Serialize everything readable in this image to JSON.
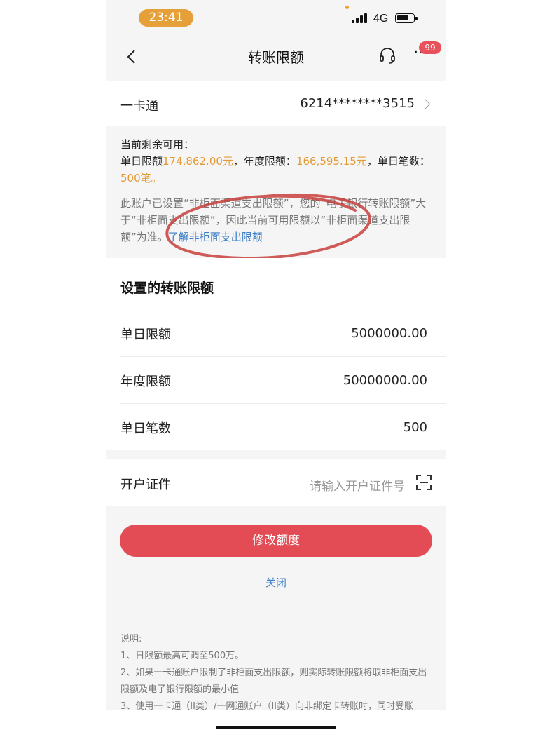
{
  "status_bar": {
    "time": "23:41",
    "network": "4G"
  },
  "nav": {
    "title": "转账限额",
    "badge": "99"
  },
  "card_row": {
    "label": "一卡通",
    "card_number": "6214********3515"
  },
  "info": {
    "heading": "当前剩余可用：",
    "daily_label": "单日限额",
    "daily_value": "174,862.00元",
    "sep1": "，年度限额：",
    "annual_value": "166,595.15元",
    "sep2": "，单日笔数：",
    "count_value": "500笔。",
    "notice": "此账户已设置“非柜面渠道支出限额”，您的“电子银行转账限额”大于“非柜面支出限额”，因此当前可用限额以“非柜面渠道支出限额”为准。",
    "notice_link": "了解非柜面支出限额"
  },
  "settings": {
    "title": "设置的转账限额",
    "rows": [
      {
        "label": "单日限额",
        "value": "5000000.00"
      },
      {
        "label": "年度限额",
        "value": "50000000.00"
      },
      {
        "label": "单日笔数",
        "value": "500"
      }
    ]
  },
  "id_row": {
    "label": "开户证件",
    "placeholder": "请输入开户证件号"
  },
  "actions": {
    "submit_label": "修改额度",
    "close_label": "关闭"
  },
  "notes": {
    "title": "说明:",
    "lines": [
      "1、日限额最高可调至500万。",
      "2、如果一卡通账户限制了非柜面支出限额，则实际转账限额将取非柜面支出限额及电子银行限额的最小值",
      "3、使用一卡通（II类）/一网通账户（II类）向非绑定卡转账时，同时受账"
    ]
  },
  "colors": {
    "accent_orange": "#e39a34",
    "link_blue": "#3c7fc8",
    "button_red": "#e34c55",
    "annotation_red": "#c8403c"
  }
}
